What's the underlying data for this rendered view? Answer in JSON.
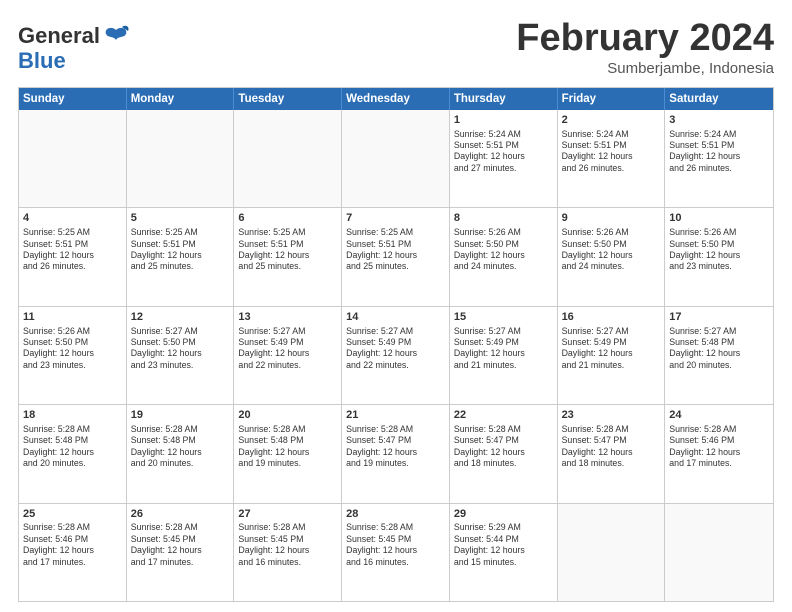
{
  "logo": {
    "text_general": "General",
    "text_blue": "Blue"
  },
  "title": "February 2024",
  "subtitle": "Sumberjambe, Indonesia",
  "header_days": [
    "Sunday",
    "Monday",
    "Tuesday",
    "Wednesday",
    "Thursday",
    "Friday",
    "Saturday"
  ],
  "weeks": [
    [
      {
        "day": "",
        "info": ""
      },
      {
        "day": "",
        "info": ""
      },
      {
        "day": "",
        "info": ""
      },
      {
        "day": "",
        "info": ""
      },
      {
        "day": "1",
        "info": "Sunrise: 5:24 AM\nSunset: 5:51 PM\nDaylight: 12 hours\nand 27 minutes."
      },
      {
        "day": "2",
        "info": "Sunrise: 5:24 AM\nSunset: 5:51 PM\nDaylight: 12 hours\nand 26 minutes."
      },
      {
        "day": "3",
        "info": "Sunrise: 5:24 AM\nSunset: 5:51 PM\nDaylight: 12 hours\nand 26 minutes."
      }
    ],
    [
      {
        "day": "4",
        "info": "Sunrise: 5:25 AM\nSunset: 5:51 PM\nDaylight: 12 hours\nand 26 minutes."
      },
      {
        "day": "5",
        "info": "Sunrise: 5:25 AM\nSunset: 5:51 PM\nDaylight: 12 hours\nand 25 minutes."
      },
      {
        "day": "6",
        "info": "Sunrise: 5:25 AM\nSunset: 5:51 PM\nDaylight: 12 hours\nand 25 minutes."
      },
      {
        "day": "7",
        "info": "Sunrise: 5:25 AM\nSunset: 5:51 PM\nDaylight: 12 hours\nand 25 minutes."
      },
      {
        "day": "8",
        "info": "Sunrise: 5:26 AM\nSunset: 5:50 PM\nDaylight: 12 hours\nand 24 minutes."
      },
      {
        "day": "9",
        "info": "Sunrise: 5:26 AM\nSunset: 5:50 PM\nDaylight: 12 hours\nand 24 minutes."
      },
      {
        "day": "10",
        "info": "Sunrise: 5:26 AM\nSunset: 5:50 PM\nDaylight: 12 hours\nand 23 minutes."
      }
    ],
    [
      {
        "day": "11",
        "info": "Sunrise: 5:26 AM\nSunset: 5:50 PM\nDaylight: 12 hours\nand 23 minutes."
      },
      {
        "day": "12",
        "info": "Sunrise: 5:27 AM\nSunset: 5:50 PM\nDaylight: 12 hours\nand 23 minutes."
      },
      {
        "day": "13",
        "info": "Sunrise: 5:27 AM\nSunset: 5:49 PM\nDaylight: 12 hours\nand 22 minutes."
      },
      {
        "day": "14",
        "info": "Sunrise: 5:27 AM\nSunset: 5:49 PM\nDaylight: 12 hours\nand 22 minutes."
      },
      {
        "day": "15",
        "info": "Sunrise: 5:27 AM\nSunset: 5:49 PM\nDaylight: 12 hours\nand 21 minutes."
      },
      {
        "day": "16",
        "info": "Sunrise: 5:27 AM\nSunset: 5:49 PM\nDaylight: 12 hours\nand 21 minutes."
      },
      {
        "day": "17",
        "info": "Sunrise: 5:27 AM\nSunset: 5:48 PM\nDaylight: 12 hours\nand 20 minutes."
      }
    ],
    [
      {
        "day": "18",
        "info": "Sunrise: 5:28 AM\nSunset: 5:48 PM\nDaylight: 12 hours\nand 20 minutes."
      },
      {
        "day": "19",
        "info": "Sunrise: 5:28 AM\nSunset: 5:48 PM\nDaylight: 12 hours\nand 20 minutes."
      },
      {
        "day": "20",
        "info": "Sunrise: 5:28 AM\nSunset: 5:48 PM\nDaylight: 12 hours\nand 19 minutes."
      },
      {
        "day": "21",
        "info": "Sunrise: 5:28 AM\nSunset: 5:47 PM\nDaylight: 12 hours\nand 19 minutes."
      },
      {
        "day": "22",
        "info": "Sunrise: 5:28 AM\nSunset: 5:47 PM\nDaylight: 12 hours\nand 18 minutes."
      },
      {
        "day": "23",
        "info": "Sunrise: 5:28 AM\nSunset: 5:47 PM\nDaylight: 12 hours\nand 18 minutes."
      },
      {
        "day": "24",
        "info": "Sunrise: 5:28 AM\nSunset: 5:46 PM\nDaylight: 12 hours\nand 17 minutes."
      }
    ],
    [
      {
        "day": "25",
        "info": "Sunrise: 5:28 AM\nSunset: 5:46 PM\nDaylight: 12 hours\nand 17 minutes."
      },
      {
        "day": "26",
        "info": "Sunrise: 5:28 AM\nSunset: 5:45 PM\nDaylight: 12 hours\nand 17 minutes."
      },
      {
        "day": "27",
        "info": "Sunrise: 5:28 AM\nSunset: 5:45 PM\nDaylight: 12 hours\nand 16 minutes."
      },
      {
        "day": "28",
        "info": "Sunrise: 5:28 AM\nSunset: 5:45 PM\nDaylight: 12 hours\nand 16 minutes."
      },
      {
        "day": "29",
        "info": "Sunrise: 5:29 AM\nSunset: 5:44 PM\nDaylight: 12 hours\nand 15 minutes."
      },
      {
        "day": "",
        "info": ""
      },
      {
        "day": "",
        "info": ""
      }
    ]
  ]
}
